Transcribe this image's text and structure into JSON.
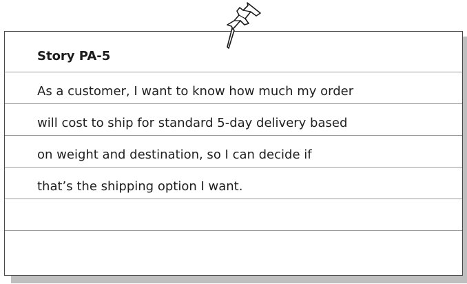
{
  "story_card": {
    "title": "Story PA-5",
    "lines": [
      "As a customer, I want to know how much my order",
      "will cost to ship for standard 5-day delivery based",
      "on weight and destination, so I can decide if",
      "that’s the shipping option I want."
    ]
  },
  "icons": {
    "pin": "pushpin-icon"
  },
  "colors": {
    "ink": "#1f1f1f",
    "rule": "#9a9a9a",
    "shadow": "#bfbfbf",
    "border": "#4a4a4a"
  }
}
